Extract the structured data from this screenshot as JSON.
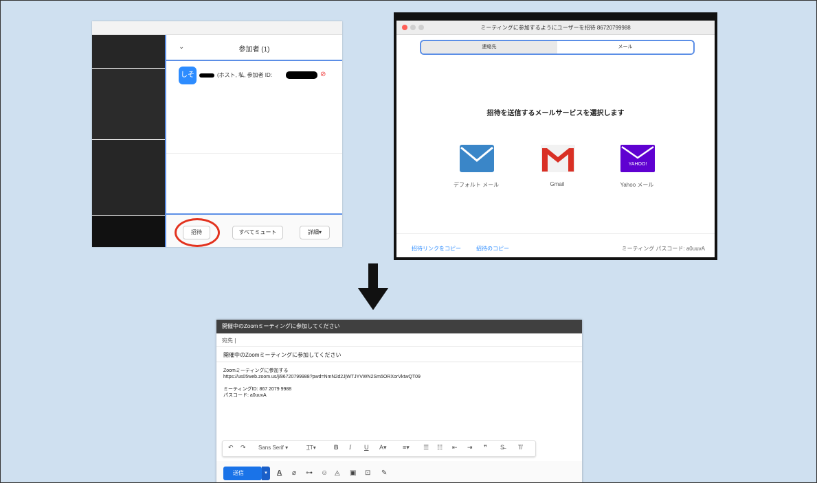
{
  "participants": {
    "title": "参加者 (1)",
    "avatar_text": "しそ",
    "row_text": "(ホスト, 私, 参加者 ID:",
    "invite_label": "招待",
    "mute_all_label": "すべてミュート",
    "more_label": "詳細▾"
  },
  "invite_dialog": {
    "window_title": "ミーティングに参加するようにユーザーを招待 86720799988",
    "tab_contacts": "連絡先",
    "tab_email": "メール",
    "heading": "招待を送信するメールサービスを選択します",
    "services": [
      {
        "label": "デフォルト メール",
        "icon": "mail-icon"
      },
      {
        "label": "Gmail",
        "icon": "gmail-icon"
      },
      {
        "label": "Yahoo メール",
        "icon": "yahoo-mail-icon",
        "logo_text": "YAHOO!"
      }
    ],
    "copy_link": "招待リンクをコピー",
    "copy_invite": "招待のコピー",
    "passcode": "ミーティング パスコード: a0uuvA"
  },
  "compose": {
    "header_title": "開催中のZoomミーティングに参加してください",
    "to_label": "宛先 |",
    "subject": "開催中のZoomミーティングに参加してください",
    "body": [
      "Zoomミーティングに参加する",
      "https://us05web.zoom.us/j/86720799988?pwd=NmN2d2JjWTJYVWN2Sm5ORXorVktwQT09",
      "ミーティングID: 867 2079 9988",
      "パスコード: a0uuvA"
    ],
    "toolbar": {
      "undo": "↶",
      "redo": "↷",
      "font": "Sans Serif ▾",
      "size": "T̲T▾",
      "bold": "B",
      "italic": "I",
      "underline": "U",
      "text_color": "A▾",
      "align": "≡▾",
      "numbered": "☰",
      "bulleted": "☷",
      "indent_less": "⇤",
      "indent_more": "⇥",
      "quote": "❞",
      "strike": "S̶",
      "clear": "T̸"
    },
    "send_label": "送信",
    "send_dropdown": "▾",
    "bottom_icons": [
      "format-icon",
      "attach-icon",
      "link-icon",
      "emoji-icon",
      "drive-icon",
      "photo-icon",
      "lock-icon",
      "pen-icon"
    ]
  },
  "colors": {
    "zoom_blue": "#2d8cff",
    "highlight_border": "#5b8ee6",
    "invite_circle": "#e2321e",
    "gmail_send": "#1a73e8",
    "background": "#cfe0f0"
  }
}
